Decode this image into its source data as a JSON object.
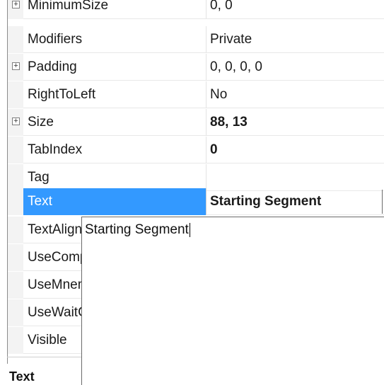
{
  "properties": [
    {
      "name": "MinimumSize",
      "value": "0, 0",
      "expandable": true,
      "bold": false
    },
    {
      "name": "Modifiers",
      "value": "Private",
      "expandable": false,
      "bold": false
    },
    {
      "name": "Padding",
      "value": "0, 0, 0, 0",
      "expandable": true,
      "bold": false
    },
    {
      "name": "RightToLeft",
      "value": "No",
      "expandable": false,
      "bold": false
    },
    {
      "name": "Size",
      "value": "88, 13",
      "expandable": true,
      "bold": true
    },
    {
      "name": "TabIndex",
      "value": "0",
      "expandable": false,
      "bold": true
    },
    {
      "name": "Tag",
      "value": "",
      "expandable": false,
      "bold": false
    },
    {
      "name": "Text",
      "value": "Starting Segment",
      "expandable": false,
      "bold": true,
      "selected": true
    },
    {
      "name": "TextAlign",
      "value": "",
      "expandable": false,
      "bold": false
    },
    {
      "name": "UseCompa",
      "value": "",
      "expandable": false,
      "bold": false
    },
    {
      "name": "UseMnem",
      "value": "",
      "expandable": false,
      "bold": false
    },
    {
      "name": "UseWaitCu",
      "value": "",
      "expandable": false,
      "bold": false
    },
    {
      "name": "Visible",
      "value": "",
      "expandable": false,
      "bold": false
    }
  ],
  "editor": {
    "text": "Starting Segment"
  },
  "description": {
    "title": "Text"
  },
  "colors": {
    "selection": "#3399ff"
  }
}
